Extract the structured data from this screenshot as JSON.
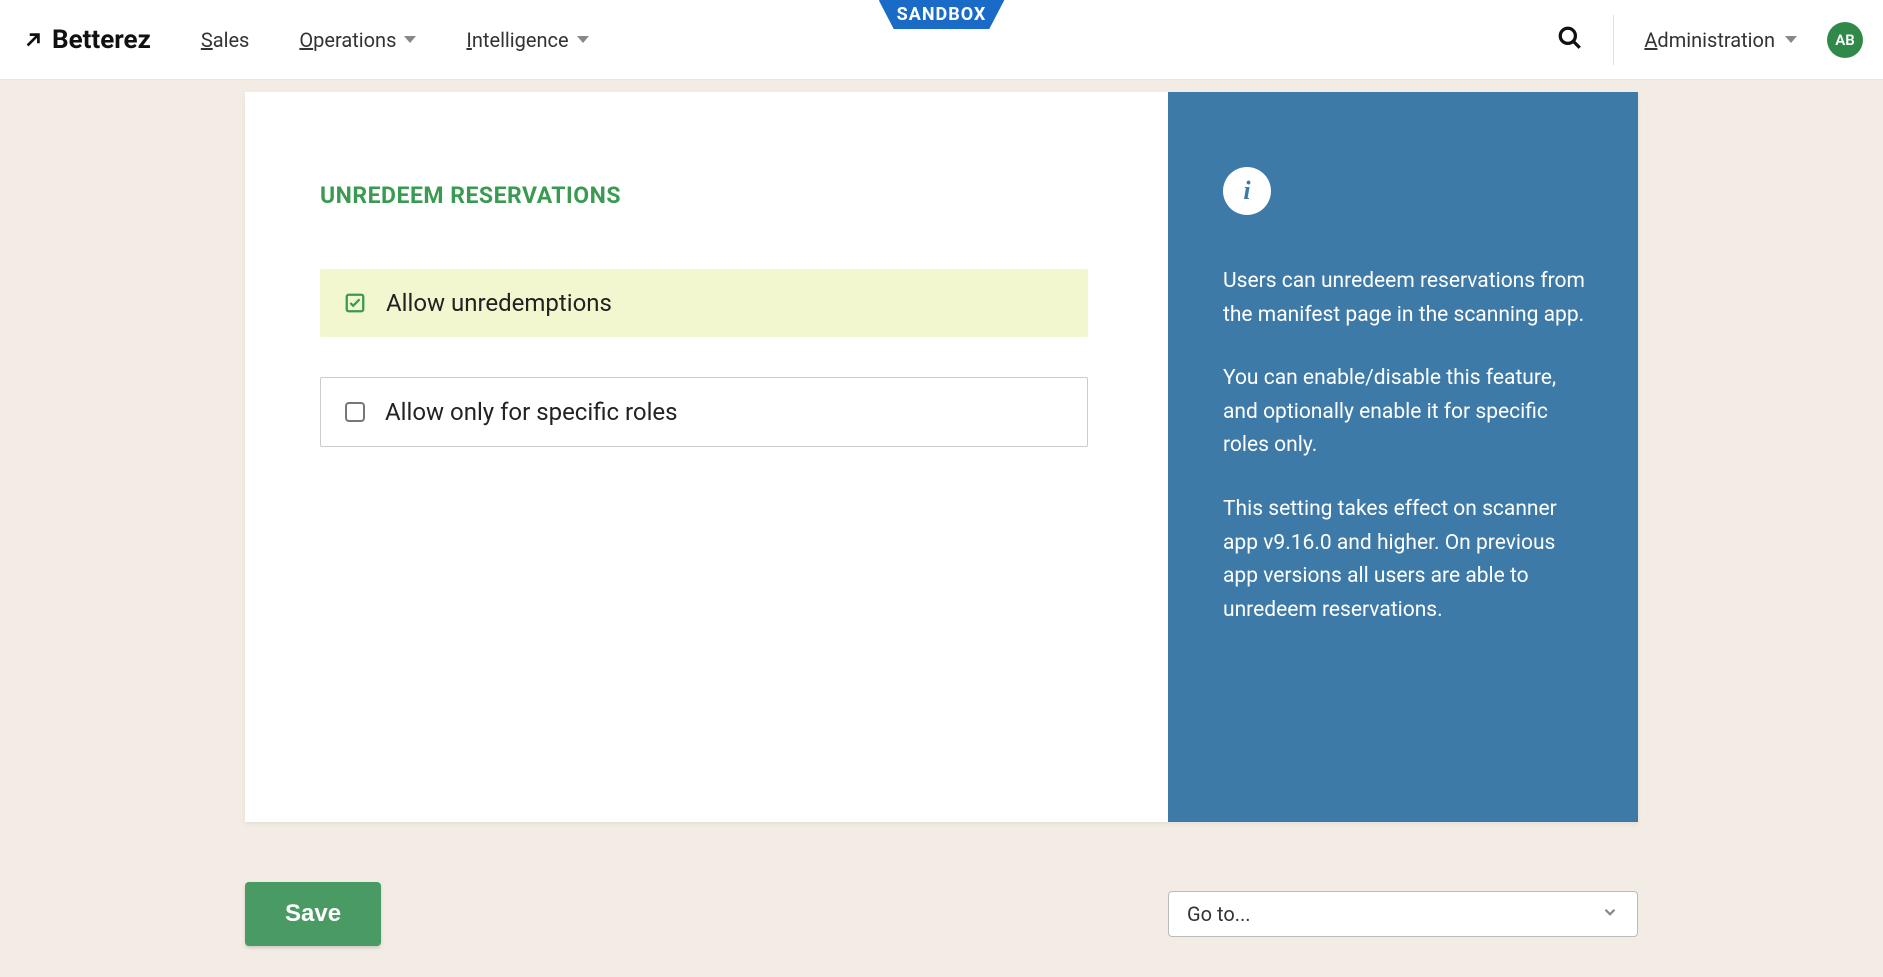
{
  "brand": "Betterez",
  "nav": {
    "sales": "Sales",
    "operations": "Operations",
    "intelligence": "Intelligence"
  },
  "sandbox_label": "SANDBOX",
  "admin_label": "Administration",
  "avatar_initials": "AB",
  "section": {
    "title": "UNREDEEM RESERVATIONS",
    "option1": "Allow unredemptions",
    "option2": "Allow only for specific roles"
  },
  "info": {
    "p1": "Users can unredeem reservations from the manifest page in the scanning app.",
    "p2": "You can enable/disable this feature, and optionally enable it for specific roles only.",
    "p3": "This setting takes effect on scanner app v9.16.0 and higher. On previous app versions all users are able to unredeem reservations."
  },
  "save_label": "Save",
  "goto_label": "Go to..."
}
